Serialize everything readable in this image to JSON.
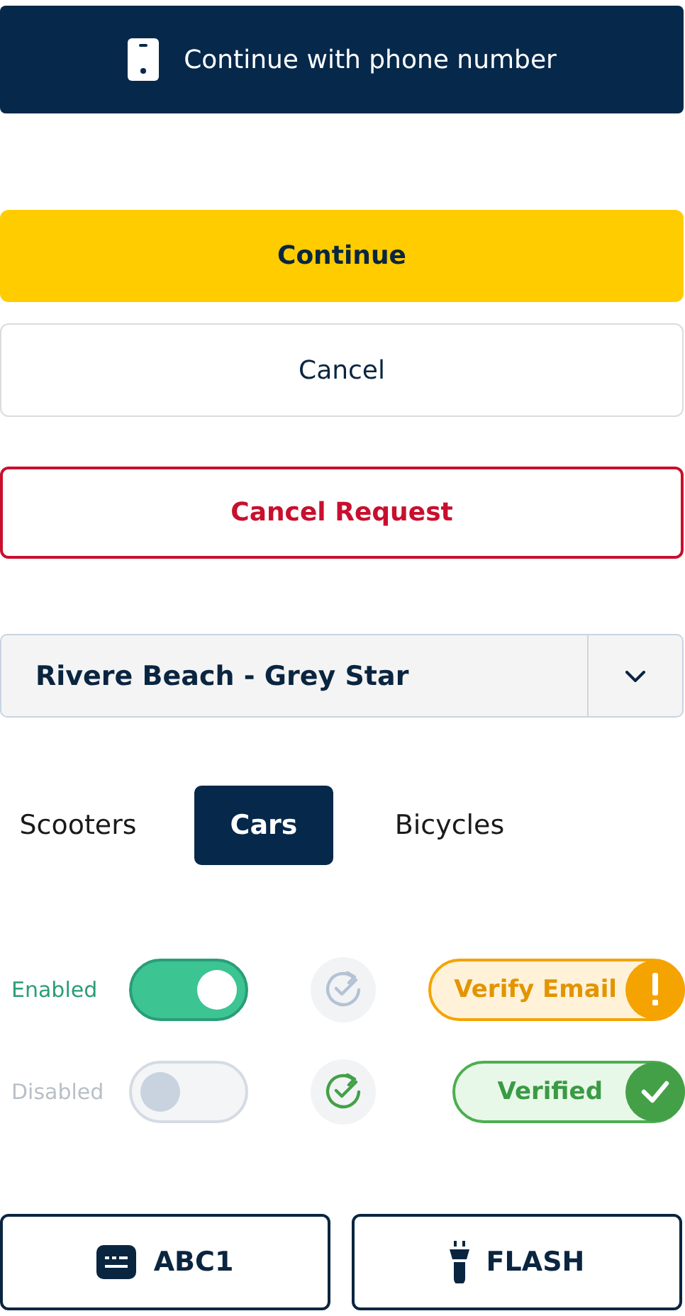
{
  "phone_button": {
    "label": "Continue with phone number"
  },
  "continue_button": {
    "label": "Continue"
  },
  "cancel_button": {
    "label": "Cancel"
  },
  "cancel_request_button": {
    "label": "Cancel Request"
  },
  "location_dropdown": {
    "value": "Rivere Beach - Grey Star"
  },
  "tabs": [
    {
      "label": "Scooters",
      "selected": false
    },
    {
      "label": "Cars",
      "selected": true
    },
    {
      "label": "Bicycles",
      "selected": false
    }
  ],
  "status_rows": [
    {
      "toggle": {
        "label": "Enabled",
        "on": true
      },
      "sync_icon": {
        "kind": "pending"
      },
      "badge": {
        "label": "Verify Email",
        "kind": "warning"
      }
    },
    {
      "toggle": {
        "label": "Disabled",
        "on": false
      },
      "sync_icon": {
        "kind": "done"
      },
      "badge": {
        "label": "Verified",
        "kind": "success"
      }
    }
  ],
  "bottom_buttons": [
    {
      "label": "ABC1",
      "kind": "plate"
    },
    {
      "label": "FLASH",
      "kind": "flash"
    }
  ]
}
